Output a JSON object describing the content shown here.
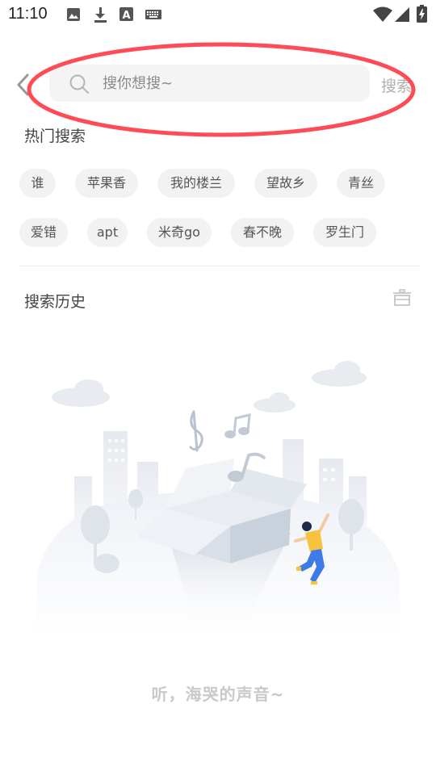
{
  "status_bar": {
    "time": "11:10"
  },
  "search": {
    "placeholder": "搜你想搜~",
    "submit_label": "搜索"
  },
  "hot_search": {
    "title": "热门搜索",
    "tags": [
      "谁",
      "苹果香",
      "我的楼兰",
      "望故乡",
      "青丝",
      "爱错",
      "apt",
      "米奇go",
      "春不晚",
      "罗生门"
    ]
  },
  "history": {
    "title": "搜索历史",
    "empty_text": "听，海哭的声音~"
  },
  "colors": {
    "highlight": "#ff4b55",
    "tag_bg": "#f2f2f2",
    "accent_person": "#f9c23c"
  }
}
